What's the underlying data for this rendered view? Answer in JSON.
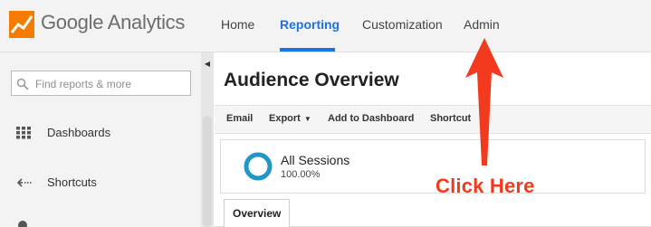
{
  "app": {
    "logo_text": "Google Analytics",
    "brand_color": "#f57c00"
  },
  "nav": {
    "items": [
      {
        "label": "Home"
      },
      {
        "label": "Reporting",
        "active": true
      },
      {
        "label": "Customization"
      },
      {
        "label": "Admin"
      }
    ],
    "active_color": "#1a73e8"
  },
  "sidebar": {
    "search": {
      "placeholder": "Find reports & more"
    },
    "items": [
      {
        "label": "Dashboards",
        "icon": "grid-icon"
      },
      {
        "label": "Shortcuts",
        "icon": "shortcut-arrow-icon"
      }
    ]
  },
  "main": {
    "title": "Audience Overview",
    "toolbar": {
      "items": [
        {
          "label": "Email"
        },
        {
          "label": "Export",
          "has_dropdown": true
        },
        {
          "label": "Add to Dashboard"
        },
        {
          "label": "Shortcut"
        }
      ]
    },
    "segment": {
      "name": "All Sessions",
      "percent": "100.00%",
      "ring_color": "#2196c8"
    },
    "tabs": [
      {
        "label": "Overview"
      }
    ]
  },
  "annotation": {
    "text": "Click Here",
    "color": "#f23a1e"
  }
}
